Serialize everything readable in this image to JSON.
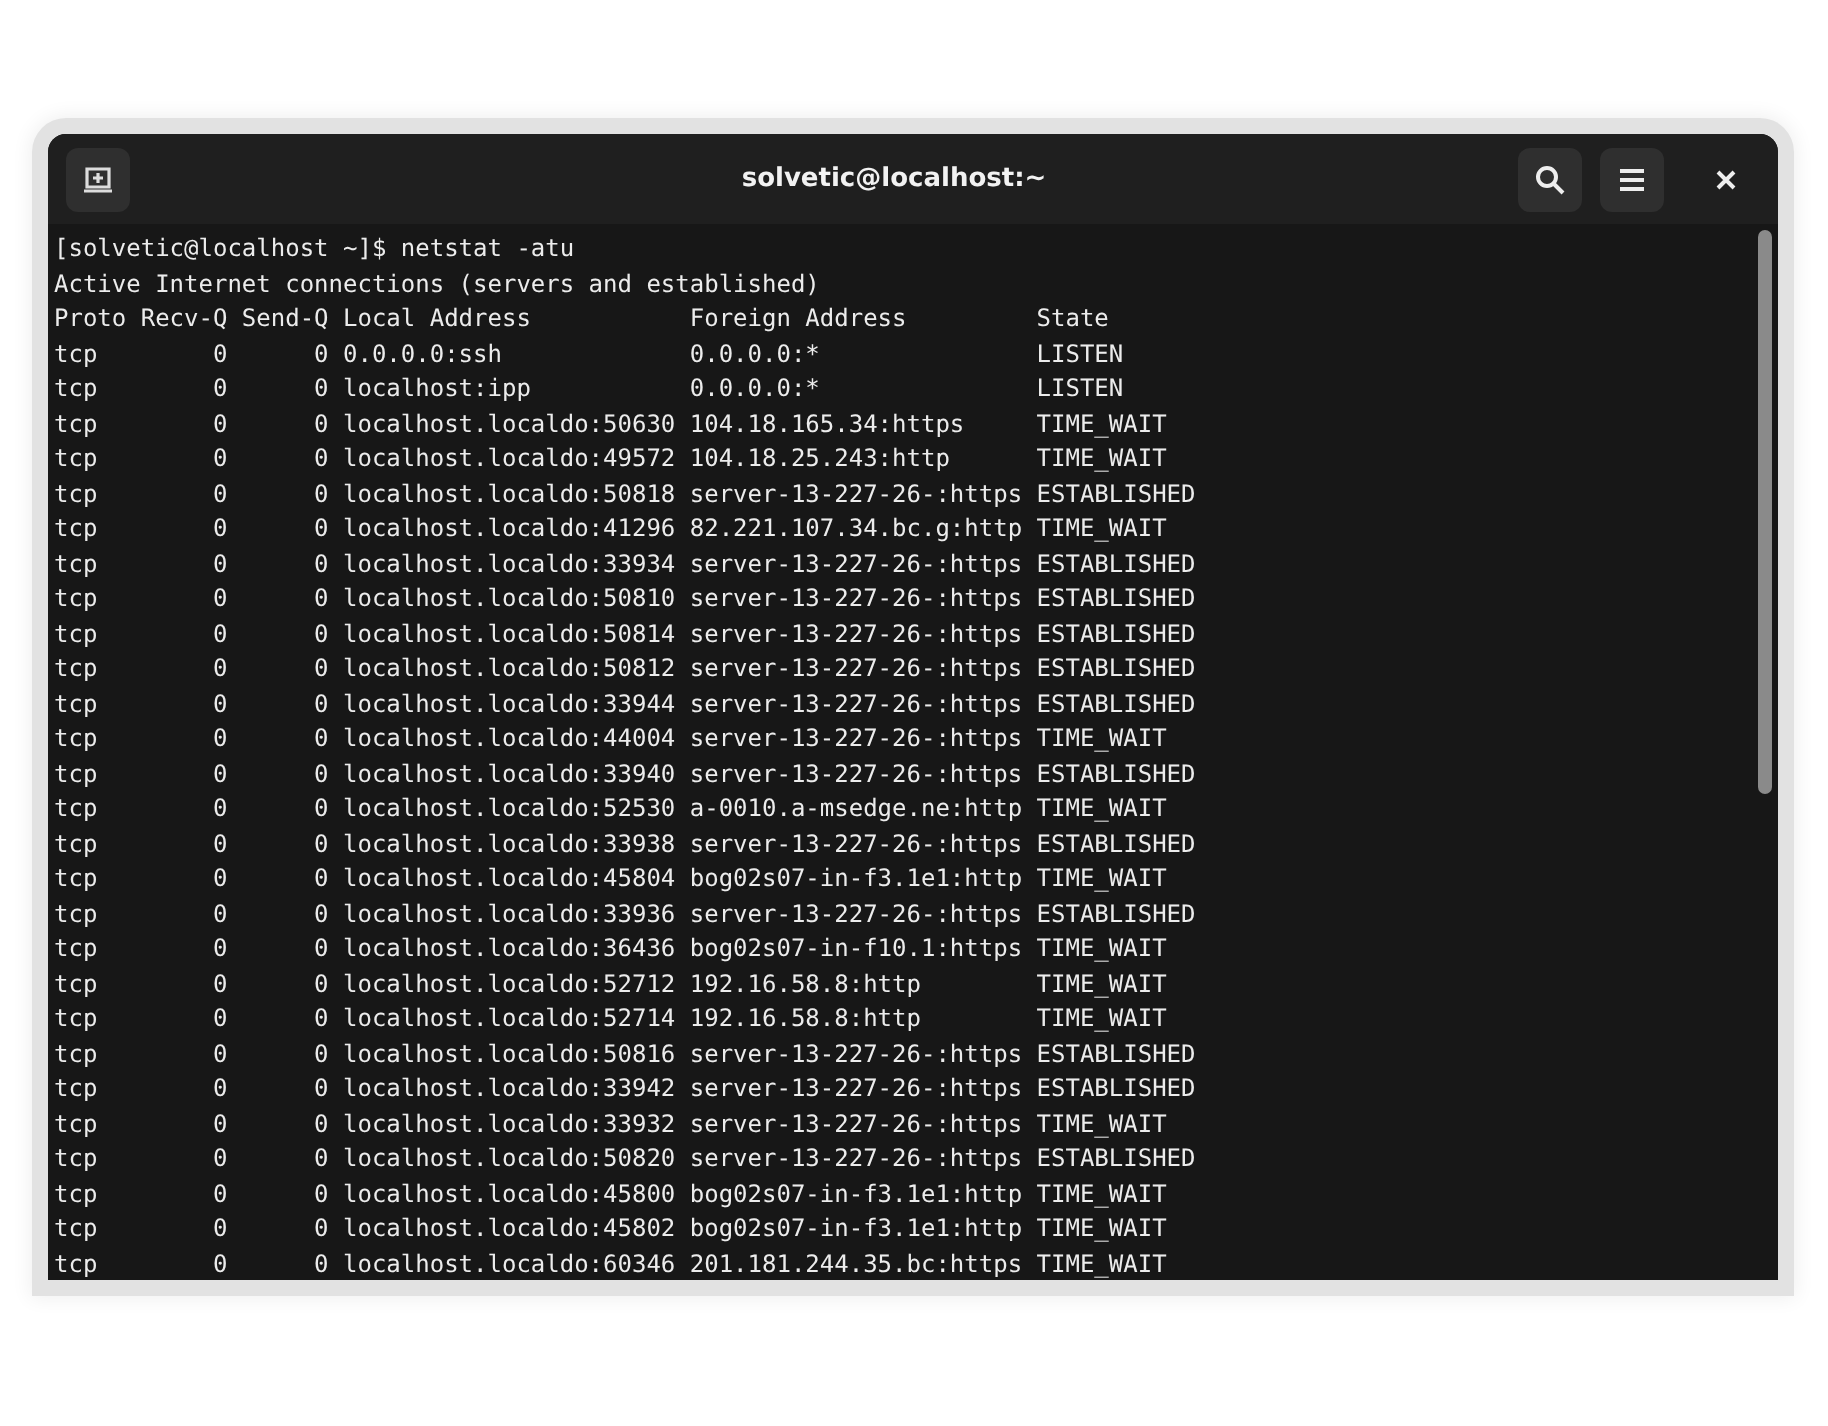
{
  "window": {
    "title": "solvetic@localhost:~"
  },
  "terminal": {
    "lines": [
      "[solvetic@localhost ~]$ netstat -atu",
      "Active Internet connections (servers and established)",
      "Proto Recv-Q Send-Q Local Address           Foreign Address         State",
      "tcp        0      0 0.0.0.0:ssh             0.0.0.0:*               LISTEN",
      "tcp        0      0 localhost:ipp           0.0.0.0:*               LISTEN",
      "tcp        0      0 localhost.localdo:50630 104.18.165.34:https     TIME_WAIT",
      "tcp        0      0 localhost.localdo:49572 104.18.25.243:http      TIME_WAIT",
      "tcp        0      0 localhost.localdo:50818 server-13-227-26-:https ESTABLISHED",
      "tcp        0      0 localhost.localdo:41296 82.221.107.34.bc.g:http TIME_WAIT",
      "tcp        0      0 localhost.localdo:33934 server-13-227-26-:https ESTABLISHED",
      "tcp        0      0 localhost.localdo:50810 server-13-227-26-:https ESTABLISHED",
      "tcp        0      0 localhost.localdo:50814 server-13-227-26-:https ESTABLISHED",
      "tcp        0      0 localhost.localdo:50812 server-13-227-26-:https ESTABLISHED",
      "tcp        0      0 localhost.localdo:33944 server-13-227-26-:https ESTABLISHED",
      "tcp        0      0 localhost.localdo:44004 server-13-227-26-:https TIME_WAIT",
      "tcp        0      0 localhost.localdo:33940 server-13-227-26-:https ESTABLISHED",
      "tcp        0      0 localhost.localdo:52530 a-0010.a-msedge.ne:http TIME_WAIT",
      "tcp        0      0 localhost.localdo:33938 server-13-227-26-:https ESTABLISHED",
      "tcp        0      0 localhost.localdo:45804 bog02s07-in-f3.1e1:http TIME_WAIT",
      "tcp        0      0 localhost.localdo:33936 server-13-227-26-:https ESTABLISHED",
      "tcp        0      0 localhost.localdo:36436 bog02s07-in-f10.1:https TIME_WAIT",
      "tcp        0      0 localhost.localdo:52712 192.16.58.8:http        TIME_WAIT",
      "tcp        0      0 localhost.localdo:52714 192.16.58.8:http        TIME_WAIT",
      "tcp        0      0 localhost.localdo:50816 server-13-227-26-:https ESTABLISHED",
      "tcp        0      0 localhost.localdo:33942 server-13-227-26-:https ESTABLISHED",
      "tcp        0      0 localhost.localdo:33932 server-13-227-26-:https TIME_WAIT",
      "tcp        0      0 localhost.localdo:50820 server-13-227-26-:https ESTABLISHED",
      "tcp        0      0 localhost.localdo:45800 bog02s07-in-f3.1e1:http TIME_WAIT",
      "tcp        0      0 localhost.localdo:45802 bog02s07-in-f3.1e1:http TIME_WAIT",
      "tcp        0      0 localhost.localdo:60346 201.181.244.35.bc:https TIME_WAIT"
    ]
  }
}
